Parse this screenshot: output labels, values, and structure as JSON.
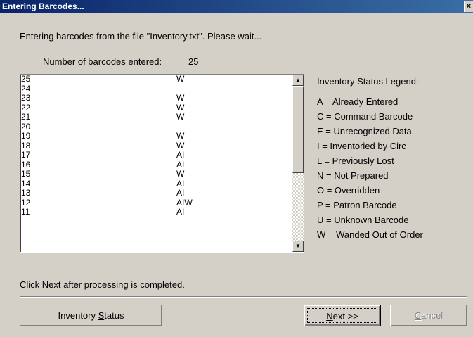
{
  "window": {
    "title": "Entering Barcodes...",
    "close_glyph": "×"
  },
  "message": "Entering barcodes from the file \"Inventory.txt\".  Please wait...",
  "count": {
    "label": "Number of barcodes entered:",
    "value": "25"
  },
  "barcodes": [
    {
      "num": "25",
      "status": "W"
    },
    {
      "num": "24",
      "status": ""
    },
    {
      "num": "23",
      "status": "W"
    },
    {
      "num": "22",
      "status": "W"
    },
    {
      "num": "21",
      "status": "W"
    },
    {
      "num": "20",
      "status": ""
    },
    {
      "num": "19",
      "status": "W"
    },
    {
      "num": "18",
      "status": "W"
    },
    {
      "num": "17",
      "status": "AI"
    },
    {
      "num": "16",
      "status": "AI"
    },
    {
      "num": "15",
      "status": "W"
    },
    {
      "num": "14",
      "status": "AI"
    },
    {
      "num": "13",
      "status": "AI"
    },
    {
      "num": "12",
      "status": "AIW"
    },
    {
      "num": "11",
      "status": "AI"
    }
  ],
  "legend": {
    "title": "Inventory Status Legend:",
    "items": [
      "A = Already Entered",
      "C = Command Barcode",
      "E = Unrecognized Data",
      "I = Inventoried by Circ",
      "L = Previously Lost",
      "N = Not Prepared",
      "O = Overridden",
      "P = Patron Barcode",
      "U = Unknown Barcode",
      "W = Wanded Out of Order"
    ]
  },
  "footer_message": "Click Next after processing is completed.",
  "buttons": {
    "inventory_status": {
      "pre": "Inventory ",
      "accel": "S",
      "post": "tatus"
    },
    "next": {
      "pre": "",
      "accel": "N",
      "post": "ext >>"
    },
    "cancel": {
      "pre": "",
      "accel": "C",
      "post": "ancel"
    }
  },
  "icons": {
    "scroll_up": "scroll-up-arrow-icon",
    "scroll_down": "scroll-down-arrow-icon",
    "close": "close-icon"
  }
}
